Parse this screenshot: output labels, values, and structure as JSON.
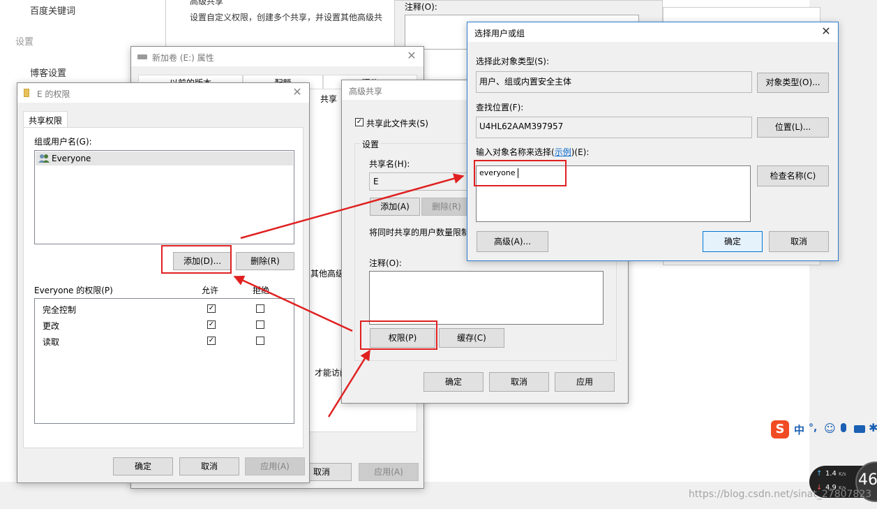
{
  "background": {
    "sidebar_items": [
      "百度关键词",
      "设置",
      "博客设置"
    ],
    "behind_texts": [
      "高级共享",
      "设置自定义权限，创建多个共享，并设置其他高级共",
      "注释(O):",
      "共享",
      "其他高级共",
      "才能访问"
    ]
  },
  "props_window": {
    "title": "新加卷 (E:) 属性",
    "tabs": [
      "以前的版本",
      "配额",
      "硬件"
    ],
    "cancel": "取消",
    "apply": "应用(A)"
  },
  "perm_window": {
    "title": "E 的权限",
    "tab": "共享权限",
    "group_label": "组或用户名(G):",
    "users": [
      "Everyone"
    ],
    "add": "添加(D)...",
    "remove": "删除(R)",
    "perm_label": "Everyone 的权限(P)",
    "allow": "允许",
    "deny": "拒绝",
    "perms": [
      {
        "name": "完全控制",
        "allow": true,
        "deny": false
      },
      {
        "name": "更改",
        "allow": true,
        "deny": false
      },
      {
        "name": "读取",
        "allow": true,
        "deny": false
      }
    ],
    "ok": "确定",
    "cancel": "取消",
    "apply": "应用(A)"
  },
  "adv_window": {
    "title": "高级共享",
    "share_checkbox": "共享此文件夹(S)",
    "settings": "设置",
    "share_name_label": "共享名(H):",
    "share_name": "E",
    "add": "添加(A)",
    "remove": "删除(R)",
    "limit_text": "将同时共享的用户数量限制",
    "comment_label": "注释(O):",
    "permissions": "权限(P)",
    "cache": "缓存(C)",
    "ok": "确定",
    "cancel": "取消",
    "apply": "应用"
  },
  "select_window": {
    "title": "选择用户或组",
    "obj_type_label": "选择此对象类型(S):",
    "obj_type_value": "用户、组或内置安全主体",
    "obj_type_btn": "对象类型(O)...",
    "location_label": "查找位置(F):",
    "location_value": "U4HL62AAM397957",
    "location_btn": "位置(L)...",
    "enter_label_pre": "输入对象名称来选择(",
    "enter_label_link": "示例",
    "enter_label_post": ")(E):",
    "enter_value": "everyone",
    "check_btn": "检查名称(C)",
    "advanced_btn": "高级(A)...",
    "ok": "确定",
    "cancel": "取消"
  },
  "tray": {
    "ime_items": [
      "中",
      "°,"
    ],
    "up_speed": "1.4",
    "up_unit": "K/s",
    "down_speed": "4.9",
    "down_unit": "K/s",
    "gauge": "46"
  },
  "watermark": "https://blog.csdn.net/sinat_27807823"
}
